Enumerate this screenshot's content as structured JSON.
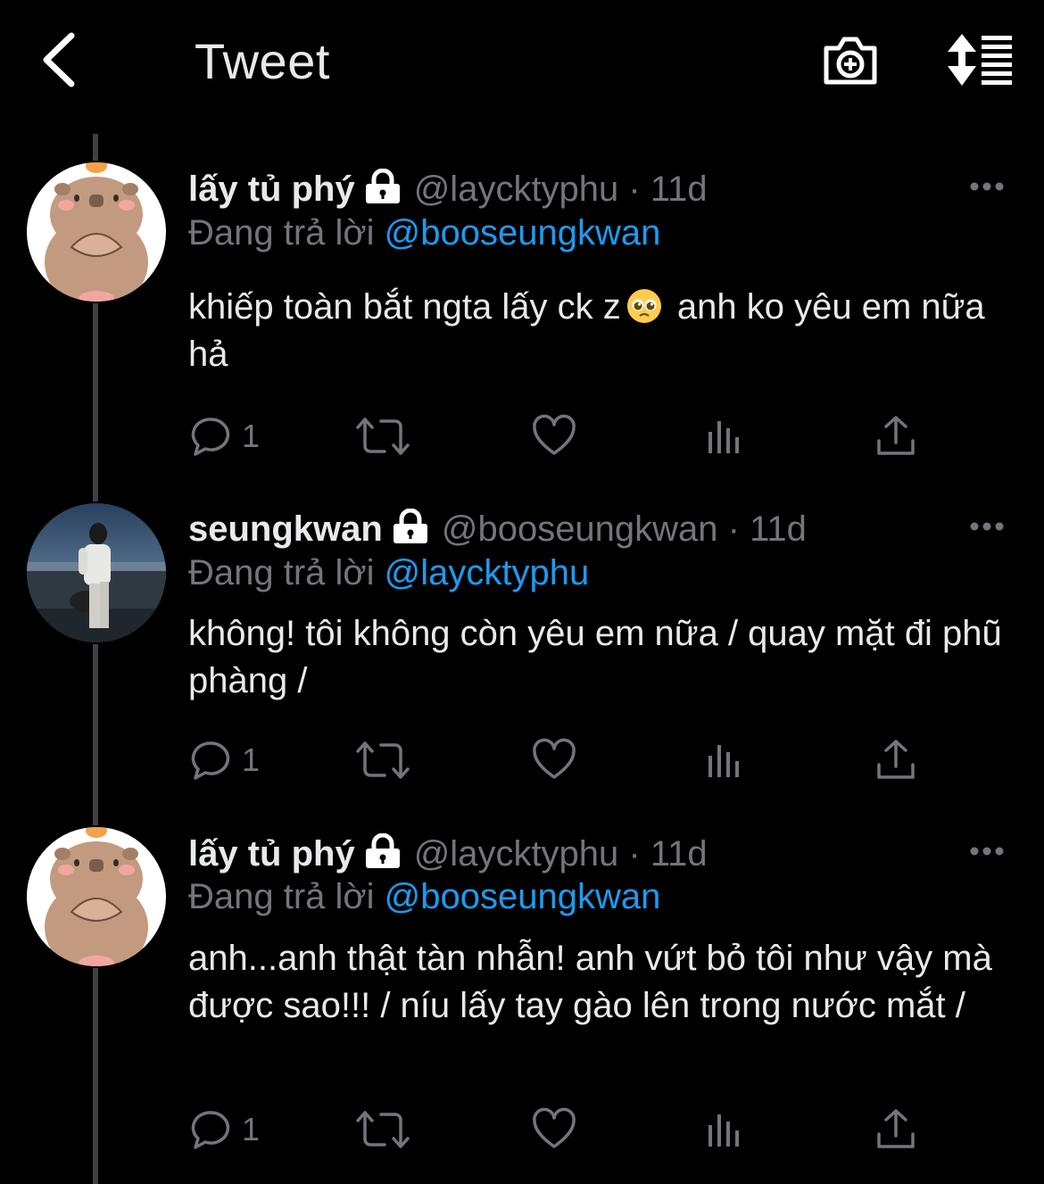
{
  "header": {
    "title": "Tweet",
    "back_icon": "back-arrow-icon",
    "camera_icon": "camera-plus-icon",
    "sort_icon": "sort-icon"
  },
  "colors": {
    "background": "#000000",
    "text": "#e7e9ea",
    "muted": "#71767b",
    "link": "#1d9bf0",
    "thread_line": "#3e4144"
  },
  "tweets": [
    {
      "name": "lấy tủ phý",
      "handle": "@laycktyphu",
      "time": "11d",
      "reply_label": "Đang trả lời",
      "reply_to": "@booseungkwan",
      "text_before_emoji": "khiếp toàn bắt ngta lấy ck z",
      "emoji": "pleading-face-emoji",
      "text_after_emoji": "anh ko yêu em nữa hả",
      "reply_count": "1"
    },
    {
      "name": "seungkwan",
      "handle": "@booseungkwan",
      "time": "11d",
      "reply_label": "Đang trả lời",
      "reply_to": "@laycktyphu",
      "text": "không! tôi không còn yêu em nữa / quay mặt đi phũ phàng /",
      "reply_count": "1"
    },
    {
      "name": "lấy tủ phý",
      "handle": "@laycktyphu",
      "time": "11d",
      "reply_label": "Đang trả lời",
      "reply_to": "@booseungkwan",
      "text": "anh...anh thật tàn nhẫn! anh vứt bỏ tôi như vậy mà được sao!!! / níu lấy tay gào lên trong nước mắt /",
      "reply_count": "1"
    }
  ]
}
